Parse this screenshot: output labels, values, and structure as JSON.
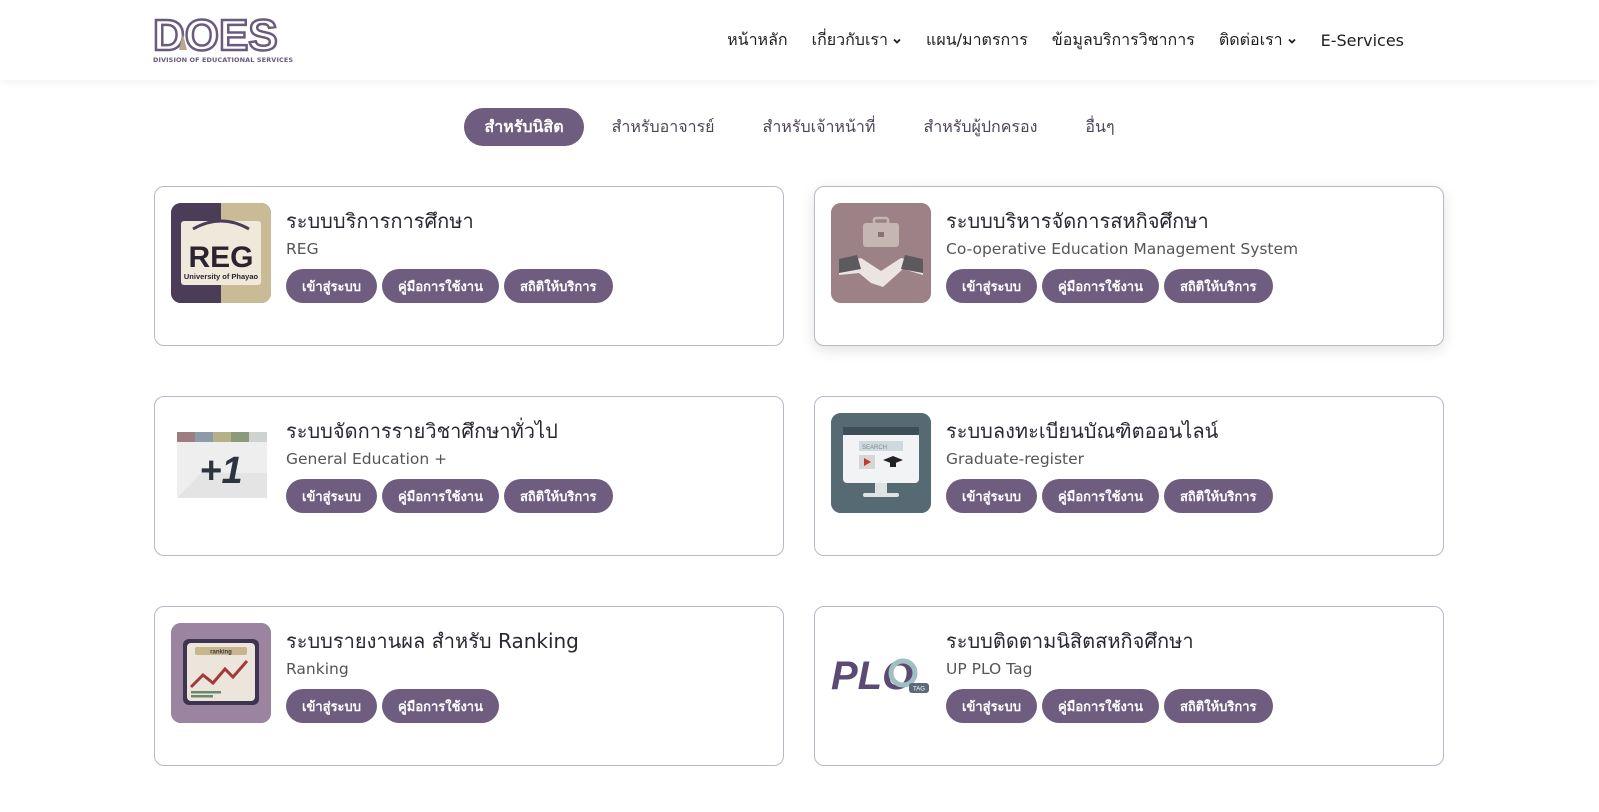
{
  "logo": {
    "mark": "DOES",
    "subtitle": "DIVISION OF EDUCATIONAL SERVICES"
  },
  "nav": {
    "items": [
      {
        "label": "หน้าหลัก"
      },
      {
        "label": "เกี่ยวกับเรา"
      },
      {
        "label": "แผน/มาตรการ"
      },
      {
        "label": "ข้อมูลบริการวิชาการ"
      },
      {
        "label": "ติดต่อเรา"
      },
      {
        "label": "E-Services"
      }
    ]
  },
  "tabs": [
    {
      "label": "สำหรับนิสิต"
    },
    {
      "label": "สำหรับอาจารย์"
    },
    {
      "label": "สำหรับเจ้าหน้าที่"
    },
    {
      "label": "สำหรับผู้ปกครอง"
    },
    {
      "label": "อื่นๆ"
    }
  ],
  "cards": [
    {
      "title": "ระบบบริการการศึกษา",
      "subtitle": "REG",
      "icon": "reg-logo-icon",
      "icon_text": "REG",
      "icon_caption": "University of Phayao",
      "buttons": [
        "เข้าสู่ระบบ",
        "คู่มือการใช้งาน",
        "สถิติให้บริการ"
      ]
    },
    {
      "title": "ระบบบริหารจัดการสหกิจศึกษา",
      "subtitle": "Co-operative Education Management System",
      "icon": "handshake-icon",
      "buttons": [
        "เข้าสู่ระบบ",
        "คู่มือการใช้งาน",
        "สถิติให้บริการ"
      ]
    },
    {
      "title": "ระบบจัดการรายวิชาศึกษาทั่วไป",
      "subtitle": "General Education +",
      "icon": "plus-one-icon",
      "icon_text": "+1",
      "buttons": [
        "เข้าสู่ระบบ",
        "คู่มือการใช้งาน",
        "สถิติให้บริการ"
      ]
    },
    {
      "title": "ระบบลงทะเบียนบัณฑิตออนไลน์",
      "subtitle": "Graduate-register",
      "icon": "monitor-graduate-icon",
      "icon_text": "SEARCH",
      "buttons": [
        "เข้าสู่ระบบ",
        "คู่มือการใช้งาน",
        "สถิติให้บริการ"
      ]
    },
    {
      "title": "ระบบรายงานผล สำหรับ Ranking",
      "subtitle": "Ranking",
      "icon": "ranking-chart-icon",
      "icon_text": "ranking",
      "buttons": [
        "เข้าสู่ระบบ",
        "คู่มือการใช้งาน"
      ]
    },
    {
      "title": "ระบบติดตามนิสิตสหกิจศึกษา",
      "subtitle": "UP PLO Tag",
      "icon": "plo-tag-logo-icon",
      "icon_text": "PLO",
      "icon_tag": "TAG",
      "buttons": [
        "เข้าสู่ระบบ",
        "คู่มือการใช้งาน",
        "สถิติให้บริการ"
      ]
    }
  ],
  "colors": {
    "accent": "#6f5d80",
    "border": "#bdb6c4",
    "text": "#2a2730"
  }
}
